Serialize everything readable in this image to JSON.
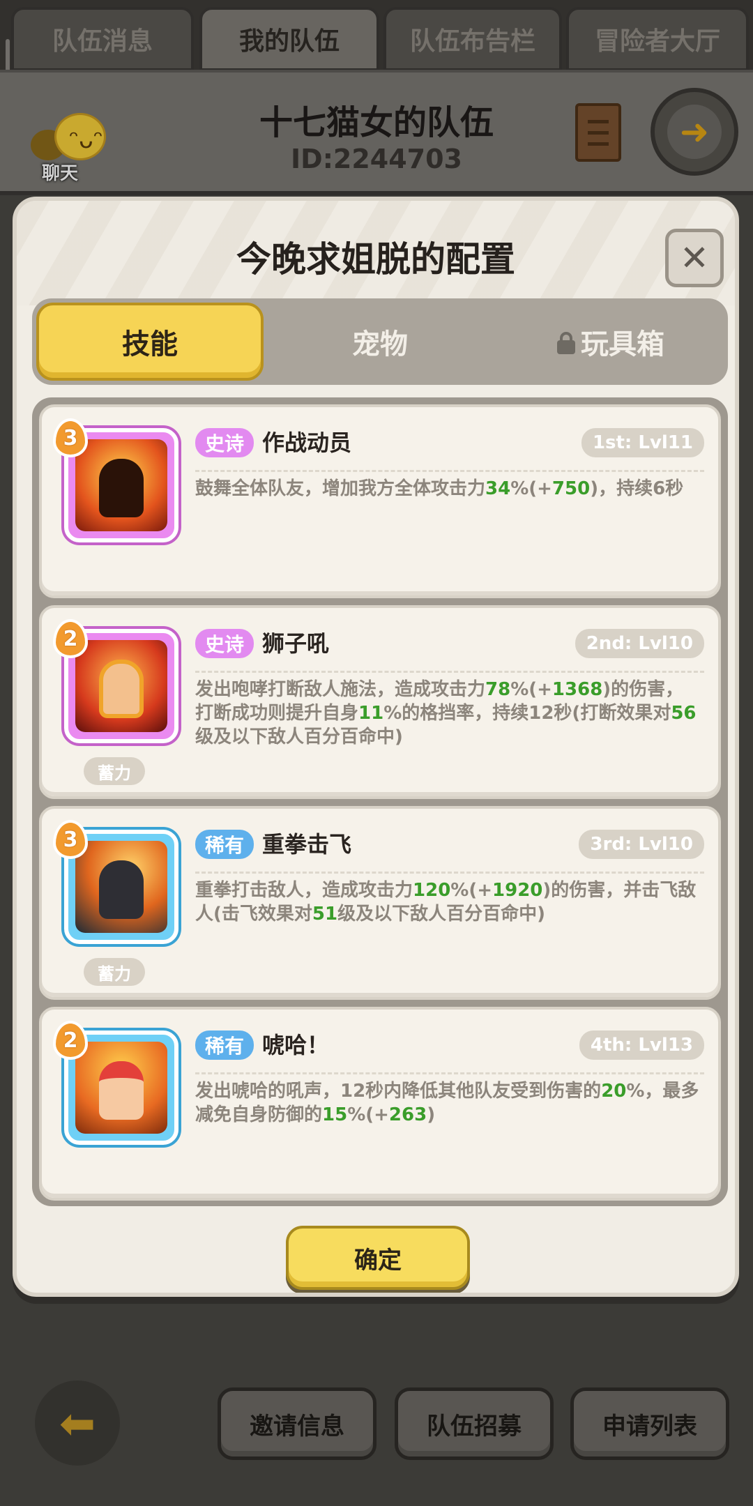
{
  "top_tabs": [
    {
      "label": "队伍消息"
    },
    {
      "label": "我的队伍"
    },
    {
      "label": "队伍布告栏"
    },
    {
      "label": "冒险者大厅"
    }
  ],
  "header": {
    "team_name": "十七猫女的队伍",
    "team_id": "ID:2244703",
    "chat_label": "聊天"
  },
  "modal": {
    "title": "今晚求姐脱的配置",
    "close_glyph": "✕",
    "tabs": [
      {
        "label": "技能"
      },
      {
        "label": "宠物"
      },
      {
        "label": "玩具箱"
      }
    ],
    "skills": [
      {
        "level": "3",
        "rarity": "史诗",
        "name": "作战动员",
        "slot": "1st: Lvl11",
        "charge": "",
        "desc": [
          {
            "t": "鼓舞全体队友，增加我方全体攻击力",
            "g": false
          },
          {
            "t": "34",
            "g": true
          },
          {
            "t": "%(+",
            "g": false
          },
          {
            "t": "750",
            "g": true
          },
          {
            "t": ")，持续6秒",
            "g": false
          }
        ]
      },
      {
        "level": "2",
        "rarity": "史诗",
        "name": "狮子吼",
        "slot": "2nd: Lvl10",
        "charge": "蓄力",
        "desc": [
          {
            "t": "发出咆哮打断敌人施法，造成攻击力",
            "g": false
          },
          {
            "t": "78",
            "g": true
          },
          {
            "t": "%(+",
            "g": false
          },
          {
            "t": "1368",
            "g": true
          },
          {
            "t": ")的伤害，打断成功则提升自身",
            "g": false
          },
          {
            "t": "11",
            "g": true
          },
          {
            "t": "%的格挡率，持续12秒(打断效果对",
            "g": false
          },
          {
            "t": "56",
            "g": true
          },
          {
            "t": "级及以下敌人百分百命中)",
            "g": false
          }
        ]
      },
      {
        "level": "3",
        "rarity": "稀有",
        "name": "重拳击飞",
        "slot": "3rd: Lvl10",
        "charge": "蓄力",
        "desc": [
          {
            "t": "重拳打击敌人，造成攻击力",
            "g": false
          },
          {
            "t": "120",
            "g": true
          },
          {
            "t": "%(+",
            "g": false
          },
          {
            "t": "1920",
            "g": true
          },
          {
            "t": ")的伤害，并击飞敌人(击飞效果对",
            "g": false
          },
          {
            "t": "51",
            "g": true
          },
          {
            "t": "级及以下敌人百分百命中)",
            "g": false
          }
        ]
      },
      {
        "level": "2",
        "rarity": "稀有",
        "name": "唬哈！",
        "slot": "4th: Lvl13",
        "charge": "",
        "desc": [
          {
            "t": "发出唬哈的吼声，12秒内降低其他队友受到伤害的",
            "g": false
          },
          {
            "t": "20",
            "g": true
          },
          {
            "t": "%，最多减免自身防御的",
            "g": false
          },
          {
            "t": "15",
            "g": true
          },
          {
            "t": "%(+",
            "g": false
          },
          {
            "t": "263",
            "g": true
          },
          {
            "t": ")",
            "g": false
          }
        ]
      }
    ],
    "confirm_label": "确定"
  },
  "bottom_bar": {
    "back_glyph": "⬅",
    "buttons": [
      {
        "label": "邀请信息"
      },
      {
        "label": "队伍招募"
      },
      {
        "label": "申请列表"
      }
    ]
  },
  "colors": {
    "accent_yellow": "#f6d455",
    "epic_purple": "#e28af0",
    "rare_blue": "#5eb0ec",
    "value_green": "#3a9d2a"
  },
  "icons": {
    "chat": "chat-bubble-icon",
    "scroll": "scroll-icon",
    "exit": "exit-icon",
    "lock": "lock-icon",
    "back": "arrow-left-icon"
  }
}
